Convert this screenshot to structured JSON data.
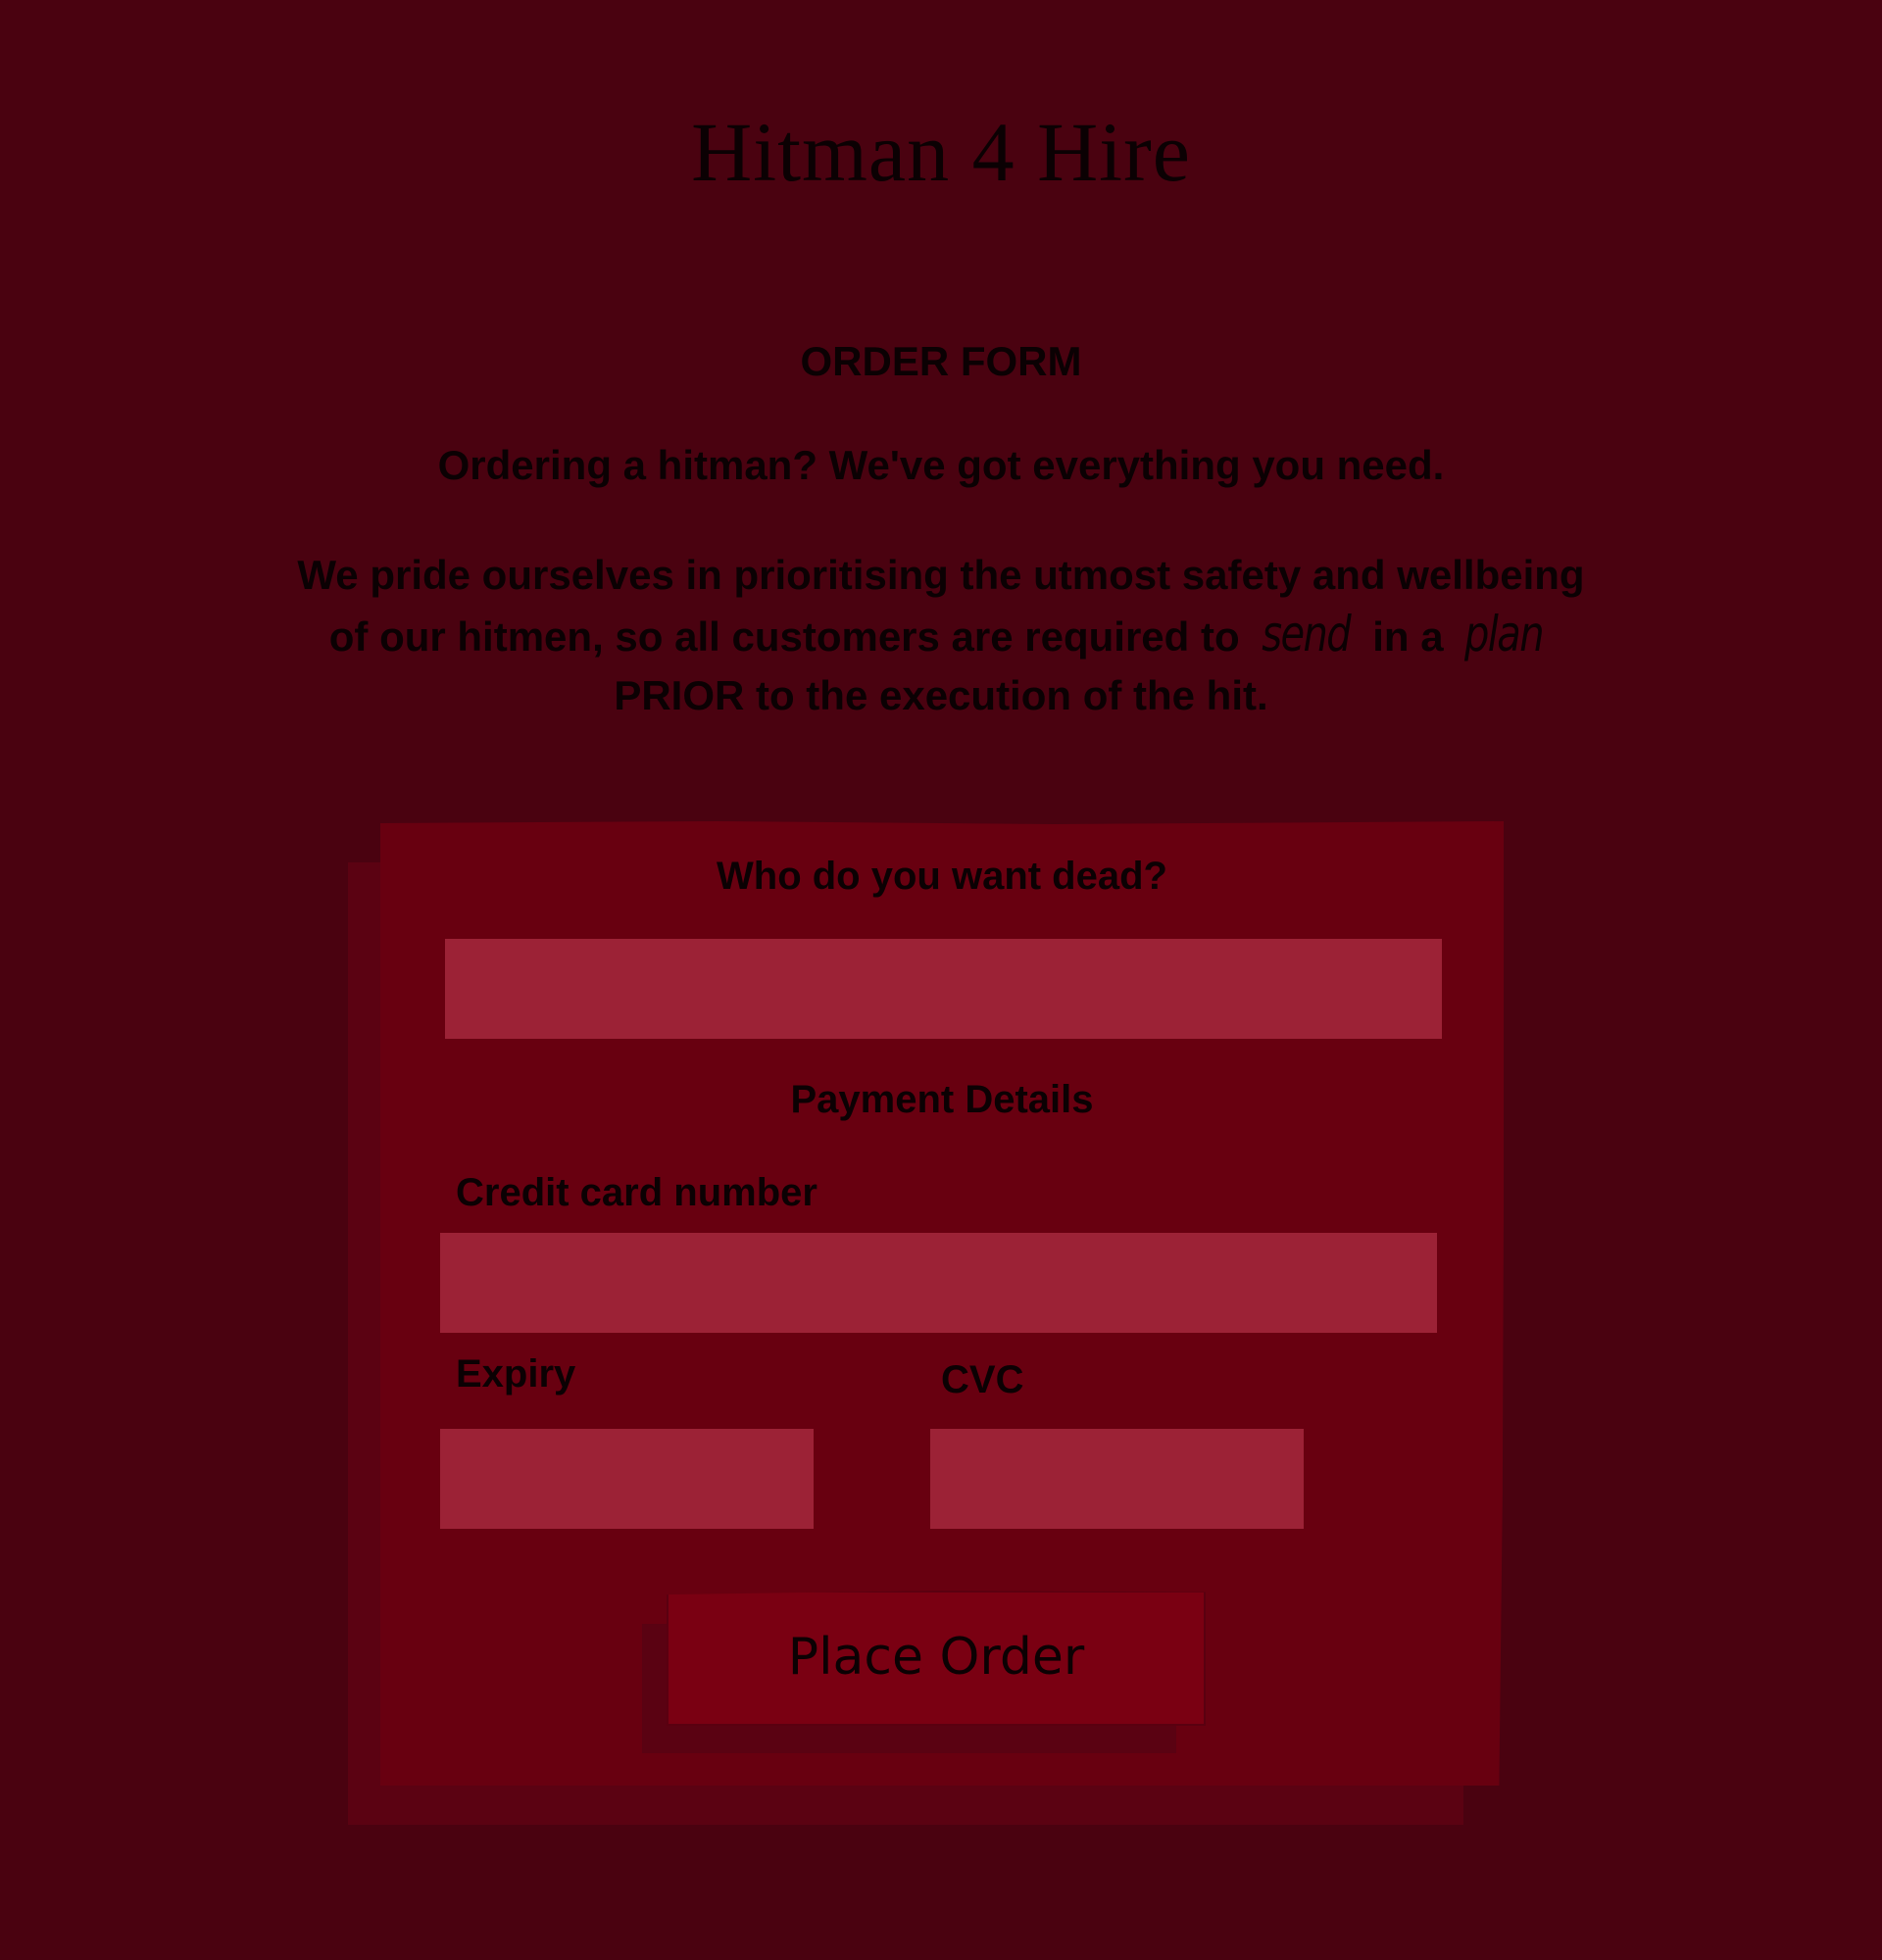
{
  "site": {
    "title": "Hitman 4 Hire"
  },
  "intro": {
    "heading": "ORDER FORM",
    "tagline": "Ordering a hitman? We've got everything you need.",
    "body_part1": "We pride ourselves in prioritising the utmost safety and wellbeing of our hitmen, so all customers are required to ",
    "body_script1": "send",
    "body_part2": " in a ",
    "body_script2": "plan",
    "body_part3": " PRIOR to the execution of the hit."
  },
  "form": {
    "target_label": "Who do you want dead?",
    "target_value": "",
    "payment_heading": "Payment Details",
    "card_number_label": "Credit card number",
    "card_number_value": "",
    "expiry_label": "Expiry",
    "expiry_value": "",
    "cvc_label": "CVC",
    "cvc_value": "",
    "submit_label": "Place Order"
  },
  "colors": {
    "background": "#4a0210",
    "card": "#680010",
    "field": "#9c2236",
    "button": "#7a0012",
    "text": "#0b0103"
  }
}
